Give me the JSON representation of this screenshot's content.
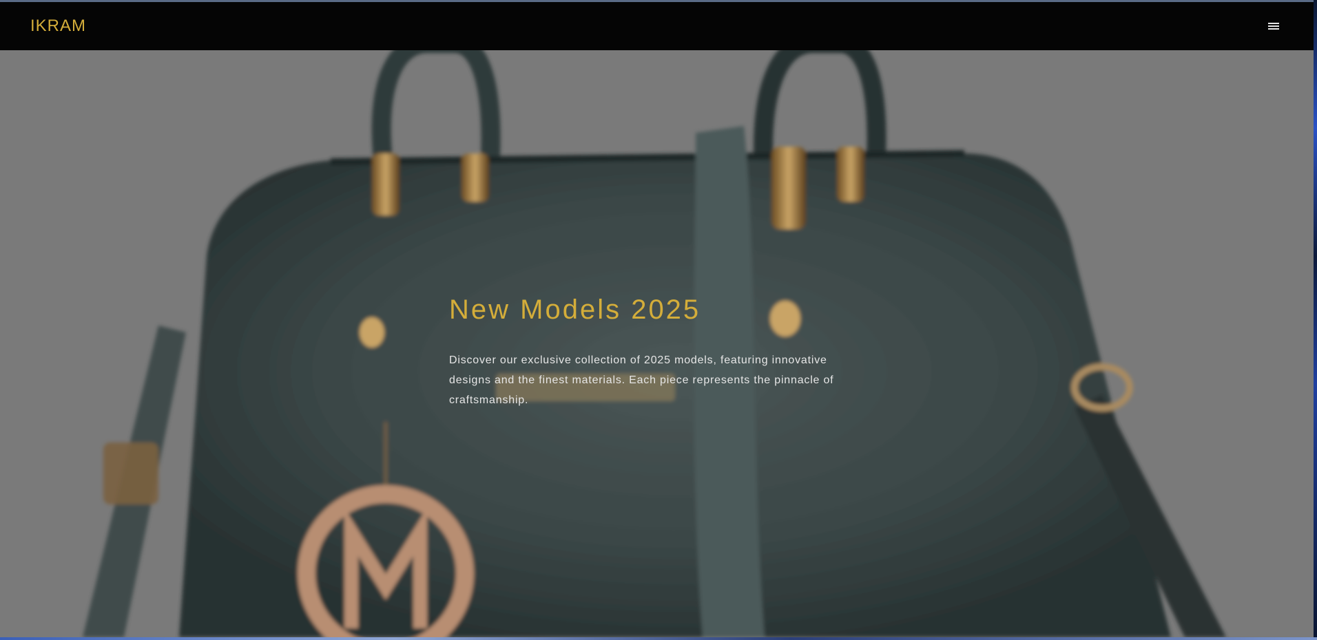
{
  "navbar": {
    "brand": "IKRAM",
    "menu_icon": "hamburger-menu-icon"
  },
  "hero": {
    "title": "New Models 2025",
    "description": "Discover our exclusive collection of 2025 models, featuring innovative designs and the finest materials. Each piece represents the pinnacle of craftsmanship.",
    "background_image": "teal-leather-handbag-with-gold-hardware",
    "title_color": "#d4ad3a"
  }
}
